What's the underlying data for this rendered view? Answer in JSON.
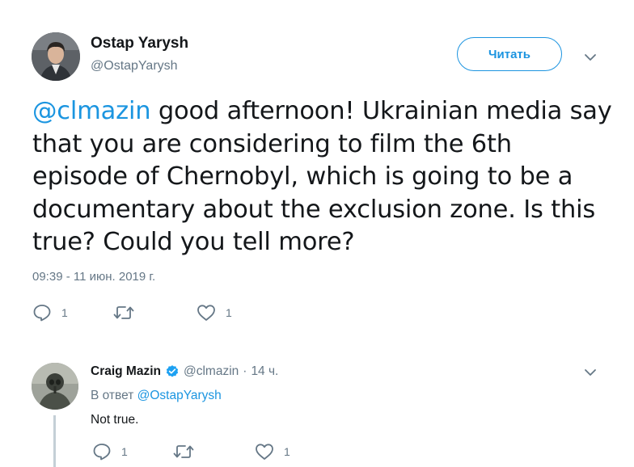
{
  "main_tweet": {
    "author_name": "Ostap Yarysh",
    "author_handle": "@OstapYarysh",
    "follow_label": "Читать",
    "text_mention": "@clmazin",
    "text_body": " good afternoon! Ukrainian media say that you are considering to film the 6th episode of Chernobyl, which is going to be a documentary about the exclusion zone. Is this true? Could you tell more?",
    "timestamp": "09:39 - 11 июн. 2019 г.",
    "reply_count": "1",
    "retweet_count": "",
    "like_count": "1"
  },
  "reply_tweet": {
    "author_name": "Craig Mazin",
    "author_handle": "@clmazin",
    "separator": "·",
    "time_ago": "14 ч.",
    "in_reply_prefix": "В ответ",
    "in_reply_to": "@OstapYarysh",
    "text": "Not true.",
    "reply_count": "1",
    "retweet_count": "",
    "like_count": "1"
  },
  "icons": {
    "verified": "verified-badge-icon",
    "reply": "reply-icon",
    "retweet": "retweet-icon",
    "like": "heart-icon",
    "more": "chevron-down-icon"
  },
  "colors": {
    "accent": "#1b95e0",
    "muted": "#657786",
    "text": "#14171a"
  }
}
